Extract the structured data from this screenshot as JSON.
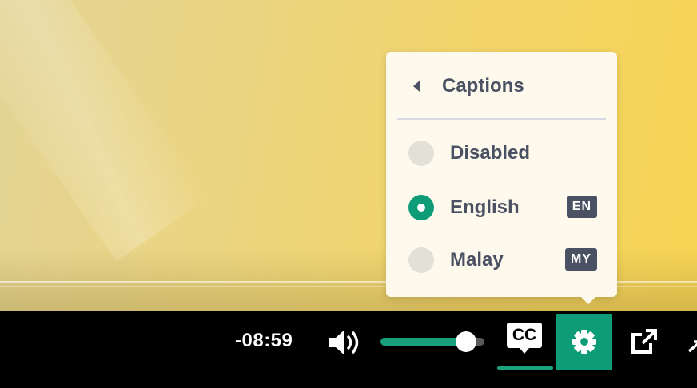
{
  "player": {
    "time_remaining": "-08:59",
    "volume_level": 0.82,
    "captions_label": "CC",
    "accent_color": "#0e9c78"
  },
  "captions_menu": {
    "title": "Captions",
    "options": [
      {
        "label": "Disabled",
        "badge": "",
        "selected": false
      },
      {
        "label": "English",
        "badge": "EN",
        "selected": true
      },
      {
        "label": "Malay",
        "badge": "MY",
        "selected": false
      }
    ]
  },
  "icons": {
    "back": "chevron-left-icon",
    "volume": "volume-icon",
    "settings": "gear-icon",
    "external": "external-link-icon",
    "fullscreen": "fullscreen-icon"
  }
}
